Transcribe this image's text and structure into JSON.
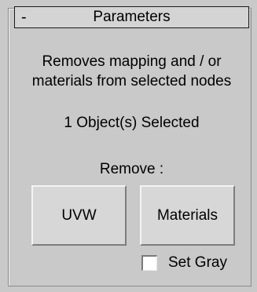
{
  "rollout": {
    "collapse_symbol": "-",
    "title": "Parameters"
  },
  "description": {
    "line1": "Removes mapping and / or",
    "line2": "materials from selected nodes"
  },
  "selection": {
    "count_text": "1 Object(s) Selected"
  },
  "remove": {
    "label": "Remove :",
    "uvw_button": "UVW",
    "materials_button": "Materials"
  },
  "set_gray": {
    "label": "Set Gray",
    "checked": false
  }
}
